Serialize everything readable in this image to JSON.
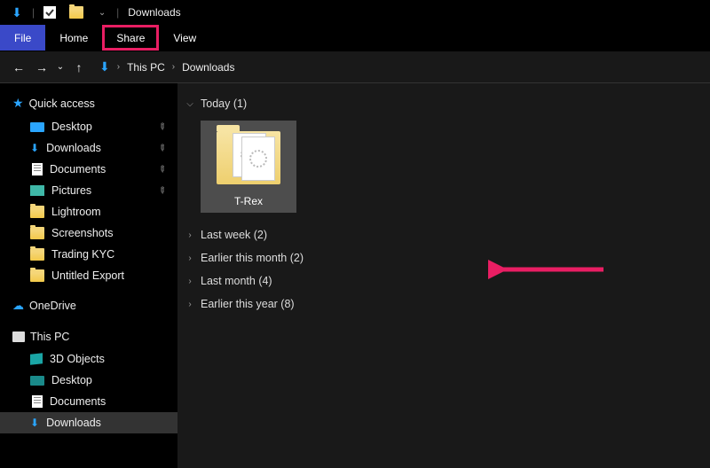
{
  "titlebar": {
    "title": "Downloads"
  },
  "ribbon": {
    "file": "File",
    "home": "Home",
    "share": "Share",
    "view": "View"
  },
  "nav": {
    "breadcrumb": {
      "root": "This PC",
      "current": "Downloads"
    }
  },
  "sidebar": {
    "quick": "Quick access",
    "quick_items": [
      {
        "label": "Desktop",
        "pin": true,
        "icon": "monitor"
      },
      {
        "label": "Downloads",
        "pin": true,
        "icon": "dl"
      },
      {
        "label": "Documents",
        "pin": true,
        "icon": "doc"
      },
      {
        "label": "Pictures",
        "pin": true,
        "icon": "pic"
      },
      {
        "label": "Lightroom",
        "pin": false,
        "icon": "folder"
      },
      {
        "label": "Screenshots",
        "pin": false,
        "icon": "folder"
      },
      {
        "label": "Trading KYC",
        "pin": false,
        "icon": "folder"
      },
      {
        "label": "Untitled Export",
        "pin": false,
        "icon": "folder"
      }
    ],
    "onedrive": "OneDrive",
    "thispc": "This PC",
    "pc_items": [
      {
        "label": "3D Objects",
        "icon": "obj3d"
      },
      {
        "label": "Desktop",
        "icon": "monitor-teal"
      },
      {
        "label": "Documents",
        "icon": "doc"
      },
      {
        "label": "Downloads",
        "icon": "dl",
        "selected": true
      }
    ]
  },
  "content": {
    "groups": [
      {
        "label": "Today (1)",
        "expanded": true,
        "items": [
          {
            "label": "T-Rex"
          }
        ]
      },
      {
        "label": "Last week (2)",
        "expanded": false
      },
      {
        "label": "Earlier this month (2)",
        "expanded": false
      },
      {
        "label": "Last month (4)",
        "expanded": false
      },
      {
        "label": "Earlier this year (8)",
        "expanded": false
      }
    ]
  }
}
